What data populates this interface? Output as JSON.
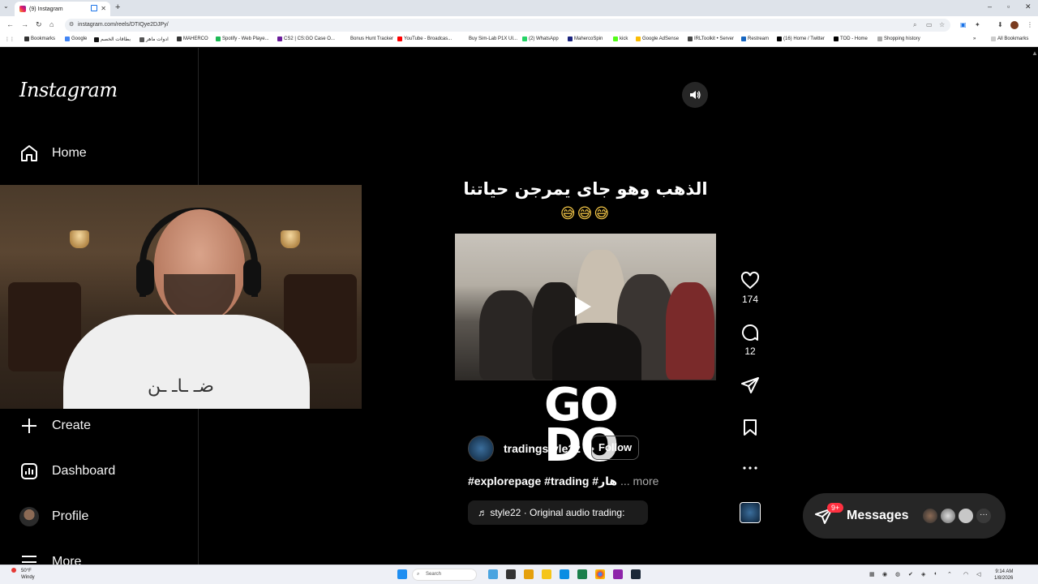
{
  "browser": {
    "tab_title": "(9) Instagram",
    "url": "instagram.com/reels/DTIQye2DJPy/",
    "bookmarks": [
      "Bookmarks",
      "Google",
      "بطاقات الخصم",
      "ادوات ماهر",
      "MAHERCO",
      "Spotify - Web Playe...",
      "CS2 | CS:GO Case O...",
      "Bonus Hunt Tracker",
      "YouTube - Broadcas...",
      "Buy Sim-Lab P1X UI...",
      "(2) WhatsApp",
      "MahercoSpin",
      "kick",
      "Google AdSense",
      "IRLToolkit • Server",
      "Restream",
      "(16) Home / Twitter",
      "TOD - Home",
      "Shopping history"
    ],
    "all_bookmarks": "All Bookmarks"
  },
  "sidebar": {
    "logo": "Instagram",
    "items": [
      {
        "label": "Home",
        "icon": "home-icon"
      },
      {
        "label": "Create",
        "icon": "plus-icon"
      },
      {
        "label": "Dashboard",
        "icon": "dashboard-icon"
      },
      {
        "label": "Profile",
        "icon": "avatar"
      },
      {
        "label": "More",
        "icon": "menu-icon"
      }
    ]
  },
  "webcam": {
    "shirt_text": "ضـ ـاـ ـن"
  },
  "reel": {
    "caption_arabic": "الذهب وهو جاى يمرجن حياتنا",
    "emojis": "😅😅😅",
    "overlay_text_1": "GO",
    "overlay_text_2": "DO",
    "author": "tradingstyle22",
    "separator": "•",
    "follow_label": "Follow",
    "hashtags": "#explorepage #trading #هار",
    "more_label": "... more",
    "audio": "♬ style22 · Original audio      trading:"
  },
  "actions": {
    "likes": "174",
    "comments": "12"
  },
  "messages": {
    "label": "Messages",
    "badge": "9+"
  },
  "taskbar": {
    "weather_temp": "50°F",
    "weather_desc": "Windy",
    "search_placeholder": "Search",
    "time": "9:14 AM",
    "date": "1/8/2026"
  }
}
